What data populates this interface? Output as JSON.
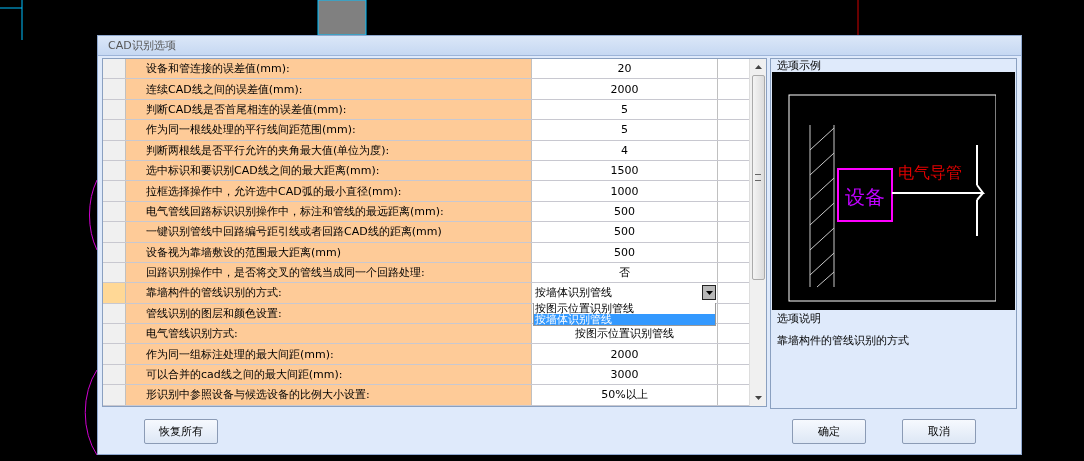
{
  "window": {
    "title": "CAD识别选项"
  },
  "rows": [
    {
      "label": "设备和管连接的误差值(mm):",
      "value": "20",
      "selected": false,
      "kind": "text"
    },
    {
      "label": "连续CAD线之间的误差值(mm):",
      "value": "2000",
      "selected": false,
      "kind": "text"
    },
    {
      "label": "判断CAD线是否首尾相连的误差值(mm):",
      "value": "5",
      "selected": false,
      "kind": "text"
    },
    {
      "label": "作为同一根线处理的平行线间距范围(mm):",
      "value": "5",
      "selected": false,
      "kind": "text"
    },
    {
      "label": "判断两根线是否平行允许的夹角最大值(单位为度):",
      "value": "4",
      "selected": false,
      "kind": "text"
    },
    {
      "label": "选中标识和要识别CAD线之间的最大距离(mm):",
      "value": "1500",
      "selected": false,
      "kind": "text"
    },
    {
      "label": "拉框选择操作中，允许选中CAD弧的最小直径(mm):",
      "value": "1000",
      "selected": false,
      "kind": "text"
    },
    {
      "label": "电气管线回路标识识别操作中，标注和管线的最远距离(mm):",
      "value": "500",
      "selected": false,
      "kind": "text"
    },
    {
      "label": "一键识别管线中回路编号距引线或者回路CAD线的距离(mm)",
      "value": "500",
      "selected": false,
      "kind": "text"
    },
    {
      "label": "设备视为靠墙敷设的范围最大距离(mm)",
      "value": "500",
      "selected": false,
      "kind": "text"
    },
    {
      "label": "回路识别操作中，是否将交叉的管线当成同一个回路处理:",
      "value": "否",
      "selected": false,
      "kind": "text"
    },
    {
      "label": "靠墙构件的管线识别的方式:",
      "value": "按墙体识别管线",
      "selected": true,
      "kind": "dropdown",
      "expanded": true,
      "options": [
        {
          "label": "按图示位置识别管线",
          "selected": false
        },
        {
          "label": "按墙体识别管线",
          "selected": true
        }
      ]
    },
    {
      "label": "管线识别的图层和颜色设置:",
      "selected": false,
      "kind": "text"
    },
    {
      "label": "电气管线识别方式:",
      "value": "按图示位置识别管线",
      "selected": false,
      "kind": "text"
    },
    {
      "label": "作为同一组标注处理的最大间距(mm):",
      "value": "2000",
      "selected": false,
      "kind": "text"
    },
    {
      "label": "可以合并的cad线之间的最大间距(mm):",
      "value": "3000",
      "selected": false,
      "kind": "text"
    },
    {
      "label": "形识别中参照设备与候选设备的比例大小设置:",
      "value": "50%以上",
      "selected": false,
      "kind": "text"
    }
  ],
  "preview": {
    "title": "选项示例",
    "device_label": "设备",
    "conduit_label": "电气导管"
  },
  "description": {
    "title": "选项说明",
    "text": "靠墙构件的管线识别的方式"
  },
  "buttons": {
    "restore": "恢复所有",
    "ok": "确定",
    "cancel": "取消"
  }
}
